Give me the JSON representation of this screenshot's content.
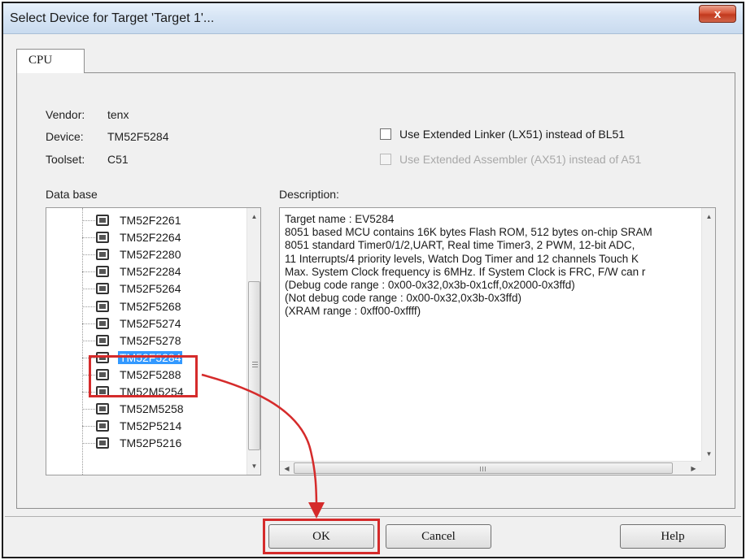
{
  "window": {
    "title": "Select Device for Target 'Target 1'...",
    "close_glyph": "x"
  },
  "tabs": [
    {
      "label": "CPU",
      "active": true
    }
  ],
  "info": {
    "vendor_label": "Vendor:",
    "vendor_value": "tenx",
    "device_label": "Device:",
    "device_value": "TM52F5284",
    "toolset_label": "Toolset:",
    "toolset_value": "C51"
  },
  "options": {
    "extended_linker": {
      "label": "Use Extended Linker (LX51) instead of BL51",
      "checked": false,
      "enabled": true
    },
    "extended_assembler": {
      "label": "Use Extended Assembler (AX51) instead of A51",
      "checked": false,
      "enabled": false
    }
  },
  "database": {
    "label": "Data base",
    "items": [
      {
        "label": "TM52F2261",
        "selected": false
      },
      {
        "label": "TM52F2264",
        "selected": false
      },
      {
        "label": "TM52F2280",
        "selected": false
      },
      {
        "label": "TM52F2284",
        "selected": false
      },
      {
        "label": "TM52F5264",
        "selected": false
      },
      {
        "label": "TM52F5268",
        "selected": false
      },
      {
        "label": "TM52F5274",
        "selected": false
      },
      {
        "label": "TM52F5278",
        "selected": false
      },
      {
        "label": "TM52F5284",
        "selected": true
      },
      {
        "label": "TM52F5288",
        "selected": false
      },
      {
        "label": "TM52M5254",
        "selected": false
      },
      {
        "label": "TM52M5258",
        "selected": false
      },
      {
        "label": "TM52P5214",
        "selected": false
      },
      {
        "label": "TM52P5216",
        "selected": false
      }
    ]
  },
  "description": {
    "label": "Description:",
    "text": "Target name : EV5284\n8051 based MCU contains 16K bytes Flash ROM, 512 bytes on-chip SRAM\n8051 standard Timer0/1/2,UART, Real time Timer3, 2 PWM, 12-bit ADC,\n11 Interrupts/4 priority levels, Watch Dog Timer and 12 channels Touch K\nMax. System Clock frequency is 6MHz. If System Clock is FRC, F/W can r\n(Debug code range : 0x00-0x32,0x3b-0x1cff,0x2000-0x3ffd)\n(Not debug code range : 0x00-0x32,0x3b-0x3ffd)\n(XRAM range : 0xff00-0xffff)"
  },
  "buttons": {
    "ok": "OK",
    "cancel": "Cancel",
    "help": "Help"
  },
  "colors": {
    "highlight_red": "#d52b2b",
    "selection_blue": "#3399ff"
  }
}
